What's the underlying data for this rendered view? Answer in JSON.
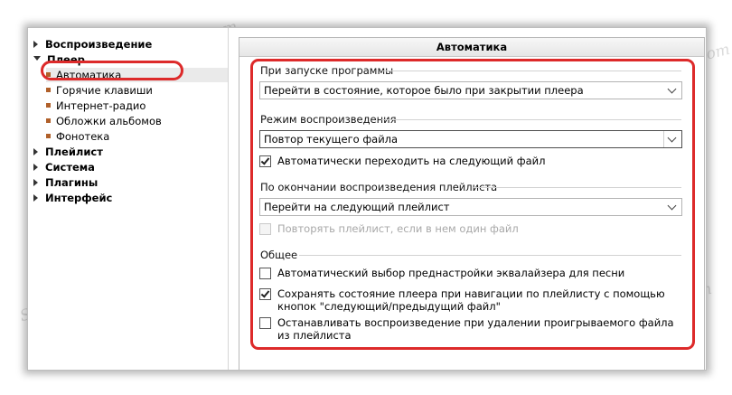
{
  "panel_title": "Автоматика",
  "tree": {
    "items": [
      {
        "label": "Воспроизведение",
        "level": 0,
        "expanded": false
      },
      {
        "label": "Плеер",
        "level": 0,
        "expanded": true
      },
      {
        "label": "Автоматика",
        "level": 1,
        "selected": true
      },
      {
        "label": "Горячие клавиши",
        "level": 1
      },
      {
        "label": "Интернет-радио",
        "level": 1
      },
      {
        "label": "Обложки альбомов",
        "level": 1
      },
      {
        "label": "Фонотека",
        "level": 1
      },
      {
        "label": "Плейлист",
        "level": 0,
        "expanded": false
      },
      {
        "label": "Система",
        "level": 0,
        "expanded": false
      },
      {
        "label": "Плагины",
        "level": 0,
        "expanded": false
      },
      {
        "label": "Интерфейс",
        "level": 0,
        "expanded": false
      }
    ]
  },
  "groups": {
    "startup": {
      "label": "При запуске программы",
      "combo_value": "Перейти в состояние, которое было при закрытии плеера"
    },
    "playback_mode": {
      "label": "Режим воспроизведения",
      "combo_value": "Повтор текущего файла",
      "auto_next": {
        "label": "Автоматически переходить на следующий файл",
        "checked": true
      }
    },
    "playlist_end": {
      "label": "По окончании воспроизведения плейлиста",
      "combo_value": "Перейти на следующий плейлист",
      "repeat_single": {
        "label": "Повторять плейлист, если в нем один файл",
        "checked": false,
        "disabled": true
      }
    },
    "general": {
      "label": "Общее",
      "eq_preset": {
        "label": "Автоматический выбор преднастройки эквалайзера для песни",
        "checked": false
      },
      "save_state": {
        "label": "Сохранять состояние плеера при навигации по плейлисту с помощью кнопок \"следующий/предыдущий файл\"",
        "checked": true
      },
      "stop_on_delete": {
        "label": "Останавливать воспроизведение при удалении проигрываемого файла из плейлиста",
        "checked": false
      }
    }
  },
  "watermark": "Soringpcrepair.com",
  "colors": {
    "highlight": "#dd2a2a",
    "bullet": "#b0602a"
  }
}
